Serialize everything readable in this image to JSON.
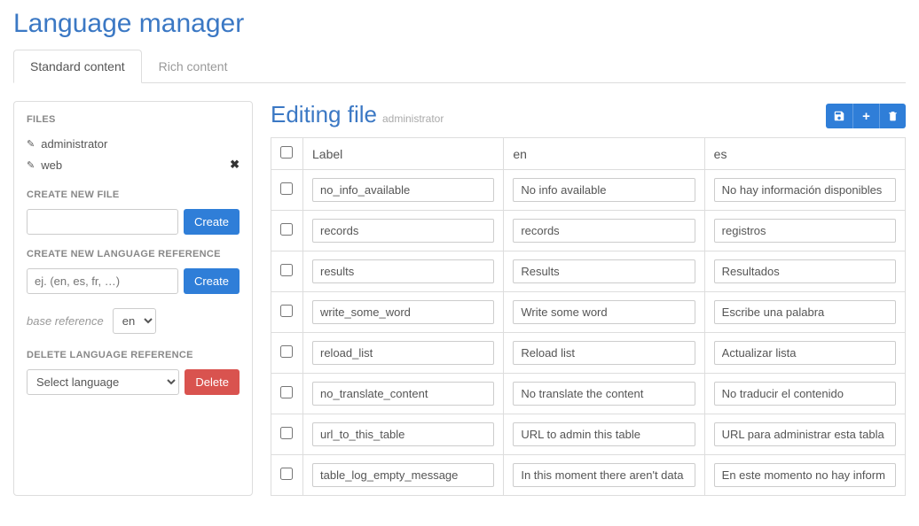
{
  "page_title": "Language manager",
  "tabs": [
    {
      "label": "Standard content",
      "active": true
    },
    {
      "label": "Rich content",
      "active": false
    }
  ],
  "sidebar": {
    "files_label": "FILES",
    "files": [
      {
        "name": "administrator",
        "removable": false
      },
      {
        "name": "web",
        "removable": true
      }
    ],
    "create_file_label": "CREATE NEW FILE",
    "create_file_button": "Create",
    "create_lang_label": "CREATE NEW LANGUAGE REFERENCE",
    "create_lang_placeholder": "ej. (en, es, fr, …)",
    "create_lang_button": "Create",
    "base_reference_label": "base reference",
    "base_reference_value": "en",
    "delete_lang_label": "DELETE LANGUAGE REFERENCE",
    "delete_lang_select": "Select language",
    "delete_lang_button": "Delete"
  },
  "main": {
    "title": "Editing file",
    "subtitle": "administrator",
    "columns": [
      "",
      "Label",
      "en",
      "es"
    ],
    "rows": [
      {
        "label": "no_info_available",
        "en": "No info available",
        "es": "No hay información disponibles"
      },
      {
        "label": "records",
        "en": "records",
        "es": "registros"
      },
      {
        "label": "results",
        "en": "Results",
        "es": "Resultados"
      },
      {
        "label": "write_some_word",
        "en": "Write some word",
        "es": "Escribe una palabra"
      },
      {
        "label": "reload_list",
        "en": "Reload list",
        "es": "Actualizar lista"
      },
      {
        "label": "no_translate_content",
        "en": "No translate the content",
        "es": "No traducir el contenido"
      },
      {
        "label": "url_to_this_table",
        "en": "URL to admin this table",
        "es": "URL para administrar esta tabla"
      },
      {
        "label": "table_log_empty_message",
        "en": "In this moment there aren't data",
        "es": "En este momento no hay inform"
      }
    ]
  }
}
